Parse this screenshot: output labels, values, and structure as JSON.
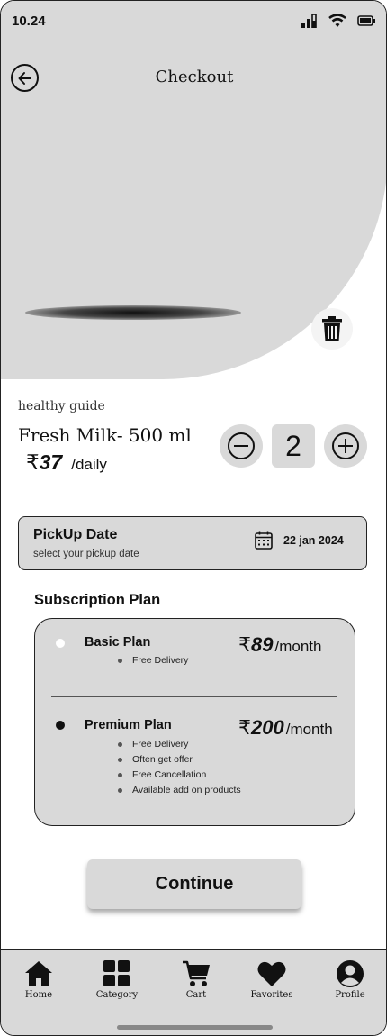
{
  "status_bar": {
    "time": "10.24"
  },
  "header": {
    "title": "Checkout"
  },
  "product": {
    "category": "healthy guide",
    "name": "Fresh Milk- 500 ml",
    "currency": "₹",
    "price": "37",
    "period": "/daily",
    "quantity": "2"
  },
  "pickup": {
    "title": "PickUp Date",
    "subtitle": "select your  pickup date",
    "date": "22 jan 2024"
  },
  "subscription": {
    "title": "Subscription Plan",
    "plans": [
      {
        "name": "Basic Plan",
        "currency": "₹",
        "price": "89",
        "period": "/month",
        "selected": false,
        "features": [
          "Free Delivery"
        ]
      },
      {
        "name": "Premium Plan",
        "currency": "₹",
        "price": "200",
        "period": "/month",
        "selected": true,
        "features": [
          "Free Delivery",
          "Often get offer",
          "Free Cancellation",
          "Available add on products"
        ]
      }
    ]
  },
  "continue_label": "Continue",
  "nav": {
    "items": [
      {
        "label": "Home",
        "icon": "home-icon"
      },
      {
        "label": "Category",
        "icon": "category-icon"
      },
      {
        "label": "Cart",
        "icon": "cart-icon"
      },
      {
        "label": "Favorites",
        "icon": "heart-icon"
      },
      {
        "label": "Profile",
        "icon": "profile-icon"
      }
    ]
  }
}
